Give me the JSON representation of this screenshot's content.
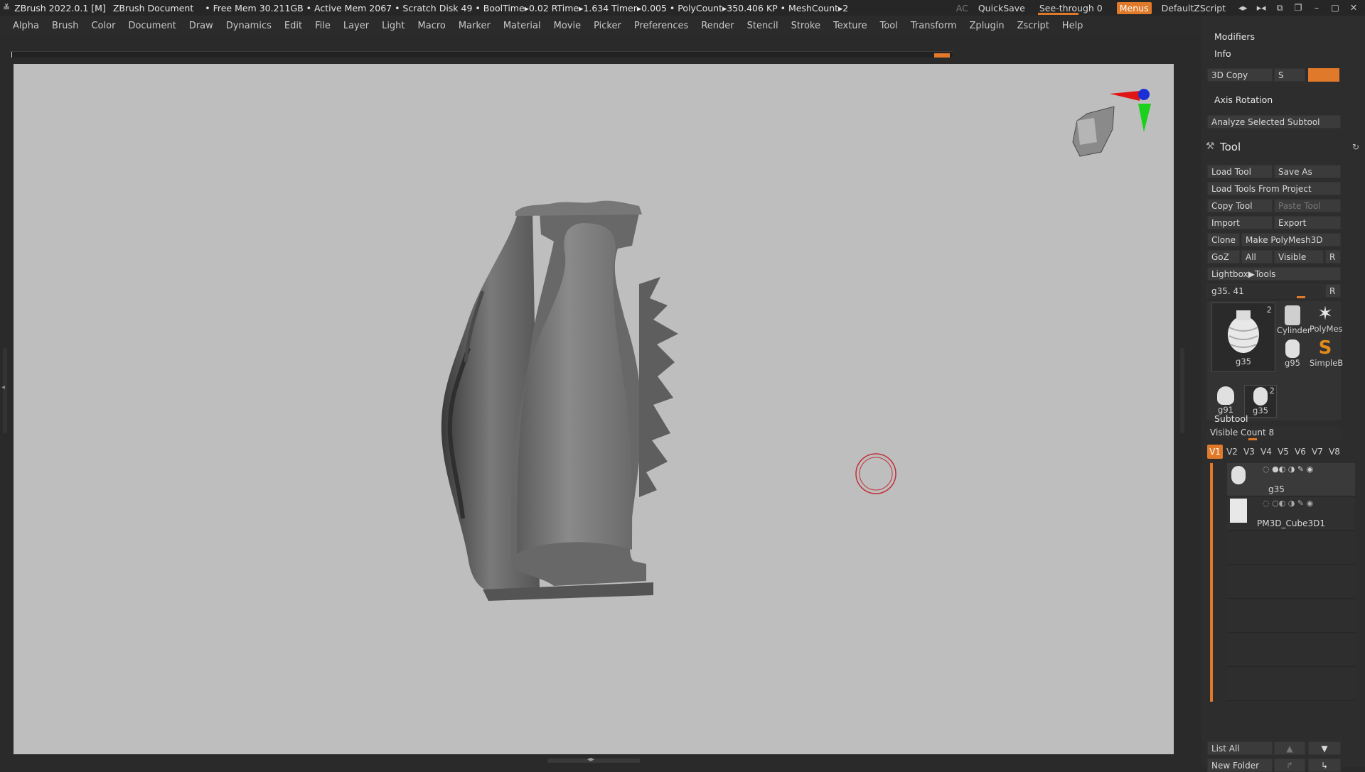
{
  "titlebar": {
    "app": "ZBrush 2022.0.1 [M]",
    "document": "ZBrush Document",
    "stats": "• Free Mem 30.211GB • Active Mem 2067 • Scratch Disk 49 •  BoolTime▸0.02 RTime▸1.634 Timer▸0.005 • PolyCount▸350.406 KP  • MeshCount▸2",
    "ac": "AC",
    "quicksave": "QuickSave",
    "seethrough": "See-through  0",
    "menus": "Menus",
    "script": "DefaultZScript"
  },
  "menubar": [
    "Alpha",
    "Brush",
    "Color",
    "Document",
    "Draw",
    "Dynamics",
    "Edit",
    "File",
    "Layer",
    "Light",
    "Macro",
    "Marker",
    "Material",
    "Movie",
    "Picker",
    "Preferences",
    "Render",
    "Stencil",
    "Stroke",
    "Texture",
    "Tool",
    "Transform",
    "Zplugin",
    "Zscript",
    "Help"
  ],
  "rpanel": {
    "modifiers": "Modifiers",
    "info": "Info",
    "copy3d": "3D Copy",
    "s_label": "S",
    "axis_rotation": "Axis Rotation",
    "analyze": "Analyze Selected Subtool",
    "tool_title": "Tool",
    "load_tool": "Load Tool",
    "save_as": "Save As",
    "load_from_project": "Load Tools From Project",
    "copy_tool": "Copy Tool",
    "paste_tool": "Paste Tool",
    "import": "Import",
    "export": "Export",
    "clone": "Clone",
    "make_polymesh": "Make PolyMesh3D",
    "goz": "GoZ",
    "all": "All",
    "visible": "Visible",
    "r": "R",
    "lightbox": "Lightbox▶Tools",
    "current_tool": "g35. 41",
    "thumbs": {
      "main_label": "g35",
      "main_count": "2",
      "cylinder": "Cylinder",
      "polymesh": "PolyMes",
      "g95": "g95",
      "simpleb": "SimpleB",
      "g91": "g91",
      "g35b": "g35",
      "g35b_count": "2"
    },
    "subtool_title": "Subtool",
    "visible_count": "Visible Count 8",
    "vtabs": [
      "V1",
      "V2",
      "V3",
      "V4",
      "V5",
      "V6",
      "V7",
      "V8"
    ],
    "subtools": [
      "g35",
      "PM3D_Cube3D1"
    ],
    "list_all": "List All",
    "new_folder": "New Folder"
  },
  "colors": {
    "accent": "#e07a2a",
    "viewport": "#bebebe",
    "panel": "#2d2d2d"
  }
}
